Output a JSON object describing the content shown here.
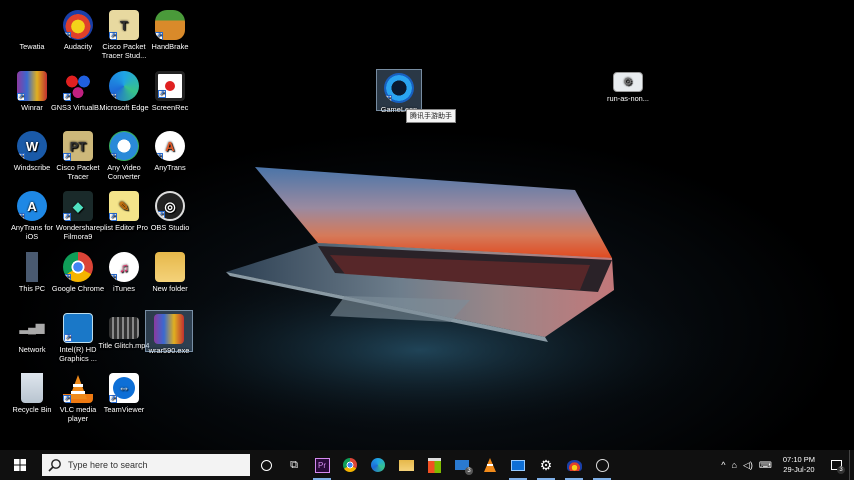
{
  "desktop": {
    "icons": [
      {
        "label": "Tewatia",
        "icon": "user-folder-icon"
      },
      {
        "label": "Audacity",
        "icon": "audacity-icon"
      },
      {
        "label": "Cisco Packet Tracer Stud...",
        "icon": "cisco-packet-tracer-student-icon"
      },
      {
        "label": "HandBrake",
        "icon": "handbrake-icon"
      },
      {
        "label": "Winrar",
        "icon": "winrar-icon"
      },
      {
        "label": "GNS3 VirtualB...",
        "icon": "gns3-icon"
      },
      {
        "label": "Microsoft Edge",
        "icon": "edge-icon"
      },
      {
        "label": "ScreenRec",
        "icon": "screenrec-icon"
      },
      {
        "label": "Windscribe",
        "icon": "windscribe-icon"
      },
      {
        "label": "Cisco Packet Tracer",
        "icon": "cisco-packet-tracer-icon"
      },
      {
        "label": "Any Video Converter",
        "icon": "any-video-converter-icon"
      },
      {
        "label": "AnyTrans",
        "icon": "anytrans-icon"
      },
      {
        "label": "AnyTrans for iOS",
        "icon": "anytrans-ios-icon"
      },
      {
        "label": "Wondershare Filmora9",
        "icon": "filmora-icon"
      },
      {
        "label": "plist Editor Pro",
        "icon": "plist-editor-icon"
      },
      {
        "label": "OBS Studio",
        "icon": "obs-icon"
      },
      {
        "label": "This PC",
        "icon": "this-pc-icon"
      },
      {
        "label": "Google Chrome",
        "icon": "chrome-icon"
      },
      {
        "label": "iTunes",
        "icon": "itunes-icon"
      },
      {
        "label": "New folder",
        "icon": "folder-icon"
      },
      {
        "label": "Network",
        "icon": "network-icon"
      },
      {
        "label": "Intel(R) HD Graphics ...",
        "icon": "intel-graphics-icon"
      },
      {
        "label": "Title Glitch.mp4",
        "icon": "video-file-icon"
      },
      {
        "label": "wrar590.exe",
        "icon": "winrar-installer-icon"
      },
      {
        "label": "Recycle Bin",
        "icon": "recycle-bin-icon"
      },
      {
        "label": "VLC media player",
        "icon": "vlc-icon"
      },
      {
        "label": "TeamViewer",
        "icon": "teamviewer-icon"
      },
      {
        "label": "GameLoop",
        "icon": "gameloop-icon"
      },
      {
        "label": "run-as-non...",
        "icon": "run-as-non-admin-icon"
      }
    ],
    "tooltip": "腾讯手游助手"
  },
  "taskbar": {
    "search_placeholder": "Type here to search",
    "apps": [
      {
        "name": "cortana",
        "icon": "cortana-icon"
      },
      {
        "name": "task-view",
        "icon": "task-view-icon"
      },
      {
        "name": "premiere-pro",
        "label": "Pr",
        "icon": "premiere-icon"
      },
      {
        "name": "chrome",
        "icon": "chrome-icon"
      },
      {
        "name": "edge",
        "icon": "edge-icon"
      },
      {
        "name": "file-explorer",
        "icon": "folder-icon"
      },
      {
        "name": "store",
        "icon": "store-icon"
      },
      {
        "name": "mail",
        "badge": "3",
        "icon": "mail-icon"
      },
      {
        "name": "vlc",
        "icon": "vlc-icon"
      },
      {
        "name": "teamviewer",
        "icon": "teamviewer-icon"
      },
      {
        "name": "settings",
        "icon": "gear-icon"
      },
      {
        "name": "audacity",
        "icon": "audacity-icon"
      },
      {
        "name": "obs",
        "icon": "obs-icon"
      }
    ],
    "tray": {
      "time": "07:10 PM",
      "date": "29-Jul-20",
      "notifications": "3"
    }
  },
  "colors": {
    "accent": "#7fb0e8",
    "taskbar": "#101010",
    "search_bg": "#f3f3f3"
  }
}
